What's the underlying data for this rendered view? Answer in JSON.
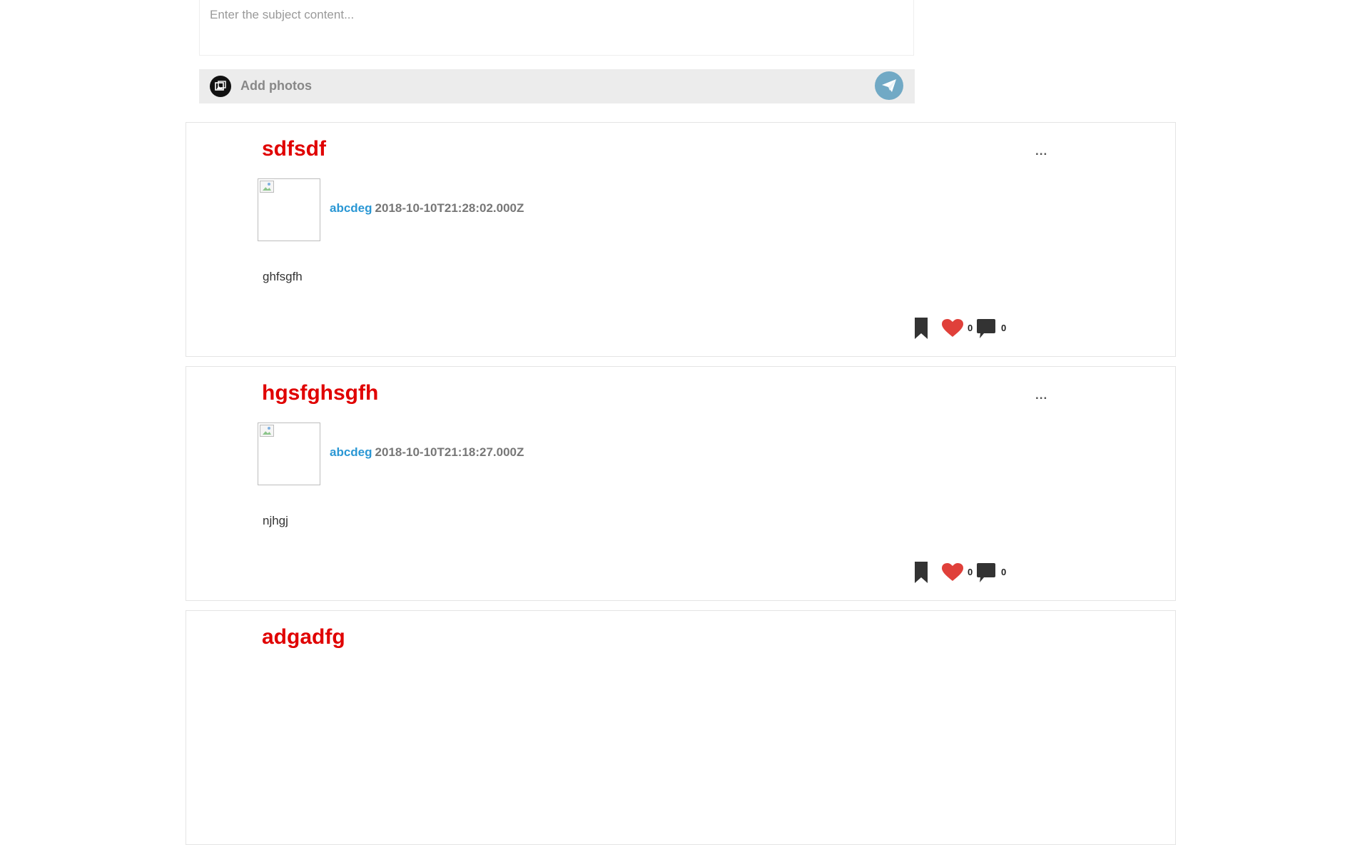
{
  "composer": {
    "placeholder": "Enter the subject content...",
    "add_photos_label": "Add photos"
  },
  "posts": [
    {
      "title": "sdfsdf",
      "menu": "...",
      "author": "abcdeg",
      "date": "2018-10-10T21:28:02.000Z",
      "body": "ghfsgfh",
      "likes": "0",
      "comments": "0"
    },
    {
      "title": "hgsfghsgfh",
      "menu": "...",
      "author": "abcdeg",
      "date": "2018-10-10T21:18:27.000Z",
      "body": "njhgj",
      "likes": "0",
      "comments": "0"
    },
    {
      "title": "adgadfg"
    }
  ],
  "colors": {
    "title": "#e00000",
    "author": "#2a97d4",
    "heart": "#e0403a",
    "send_button": "#71a9c5"
  },
  "icons": {
    "photo": "add-photo-icon",
    "send": "paper-plane-icon",
    "bookmark": "bookmark-icon",
    "like": "heart-icon",
    "comment": "comment-icon"
  }
}
